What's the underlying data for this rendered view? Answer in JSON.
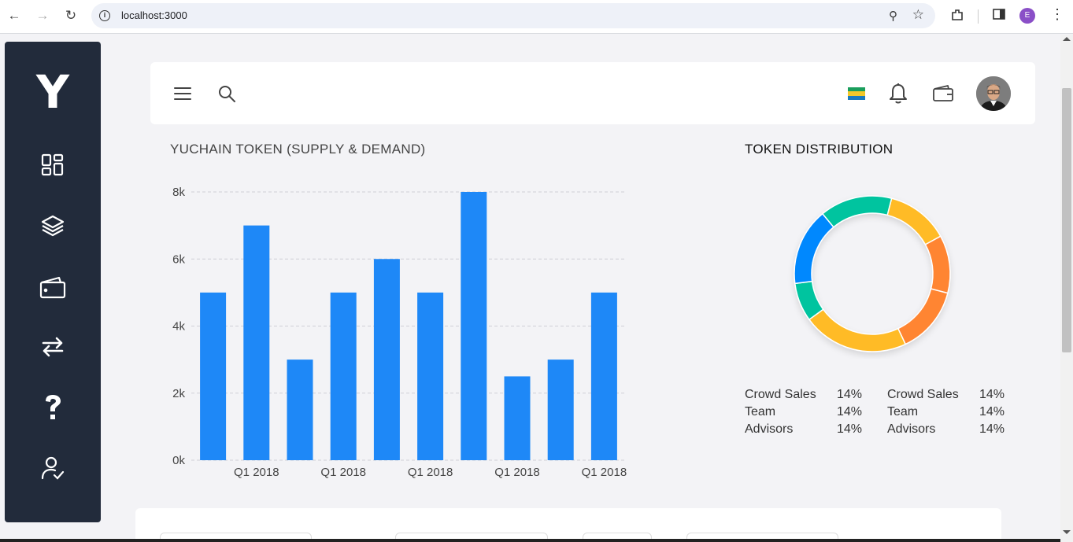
{
  "browser": {
    "url": "localhost:3000",
    "profile_initial": "E"
  },
  "sidebar": {
    "logo": "Y",
    "items": [
      {
        "icon": "dashboard-icon"
      },
      {
        "icon": "layers-icon"
      },
      {
        "icon": "wallet-icon"
      },
      {
        "icon": "transfer-icon"
      },
      {
        "icon": "help-icon"
      },
      {
        "icon": "user-check-icon"
      }
    ]
  },
  "header": {
    "icons": [
      "hamburger-menu-icon",
      "search-icon",
      "flag-icon",
      "bell-icon",
      "wallet-icon",
      "avatar"
    ]
  },
  "supply_chart": {
    "title": "YUCHAIN TOKEN (SUPPLY & DEMAND)"
  },
  "chart_data": {
    "type": "bar",
    "title": "YUCHAIN TOKEN (SUPPLY & DEMAND)",
    "values": [
      5000,
      7000,
      3000,
      5000,
      6000,
      5000,
      8000,
      2500,
      3000,
      5000
    ],
    "x_tick_labels": [
      "",
      "Q1 2018",
      "",
      "Q1 2018",
      "",
      "Q1 2018",
      "",
      "Q1 2018",
      "",
      "Q1 2018"
    ],
    "y_ticks": [
      "0k",
      "2k",
      "4k",
      "6k",
      "8k"
    ],
    "ylim": [
      0,
      8000
    ],
    "grid": true,
    "color": "#1e88f7"
  },
  "distribution": {
    "title": "TOKEN DISTRIBUTION",
    "segments": [
      {
        "color": "#ffbb28",
        "value": 13
      },
      {
        "color": "#ff8533",
        "value": 12
      },
      {
        "color": "#ff8533",
        "value": 14
      },
      {
        "color": "#ffbb28",
        "value": 22
      },
      {
        "color": "#00c49f",
        "value": 8
      },
      {
        "color": "#0088fe",
        "value": 16
      },
      {
        "color": "#00c49f",
        "value": 15
      }
    ],
    "legend_left": [
      {
        "label": "Crowd Sales",
        "pct": "14%"
      },
      {
        "label": "Team",
        "pct": "14%"
      },
      {
        "label": "Advisors",
        "pct": "14%"
      }
    ],
    "legend_right": [
      {
        "label": "Crowd Sales",
        "pct": "14%"
      },
      {
        "label": "Team",
        "pct": "14%"
      },
      {
        "label": "Advisors",
        "pct": "14%"
      }
    ]
  }
}
